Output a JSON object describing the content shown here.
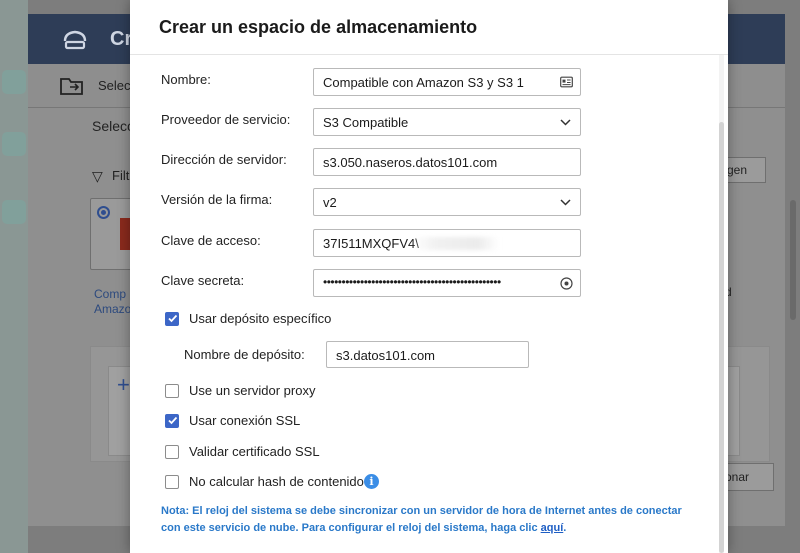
{
  "background": {
    "app_title": "Cr",
    "toolbar_label": "Selec",
    "subtitle": "Selecc",
    "filter_label": "Filt",
    "card_caption_line1": "Comp",
    "card_caption_line2": "Amazo",
    "right_button_label": "gen",
    "bottom_button_label": "onar",
    "right_text": "d"
  },
  "dialog": {
    "title": "Crear un espacio de almacenamiento",
    "fields": {
      "name": {
        "label": "Nombre:",
        "value": "Compatible con Amazon S3 y S3 1"
      },
      "provider": {
        "label": "Proveedor de servicio:",
        "value": "S3 Compatible"
      },
      "server": {
        "label": "Dirección de servidor:",
        "value": "s3.050.naseros.datos101.com"
      },
      "signature": {
        "label": "Versión de la firma:",
        "value": "v2"
      },
      "access_key": {
        "label": "Clave de acceso:",
        "value": "37I511MXQFV4\\"
      },
      "secret_key": {
        "label": "Clave secreta:",
        "value": "••••••••••••••••••••••••••••••••••••••••••••••••"
      }
    },
    "specific_bucket": {
      "label": "Usar depósito específico",
      "checked": true
    },
    "bucket_name": {
      "label": "Nombre de depósito:",
      "value": "s3.datos101.com"
    },
    "proxy": {
      "label": "Use un servidor proxy",
      "checked": false
    },
    "ssl": {
      "label": "Usar conexión SSL",
      "checked": true
    },
    "validate_cert": {
      "label": "Validar certificado SSL",
      "checked": false
    },
    "no_hash": {
      "label": "No calcular hash de contenido",
      "checked": false
    },
    "note_text": "Nota: El reloj del sistema se debe sincronizar con un servidor de hora de Internet antes de conectar con este servicio de nube. Para configurar el reloj del sistema, haga clic ",
    "note_link": "aquí",
    "note_end": "."
  },
  "colors": {
    "accent": "#3c66c7",
    "note": "#2a79c9",
    "info": "#3a8de6",
    "titlebar": "#2e3d57"
  }
}
